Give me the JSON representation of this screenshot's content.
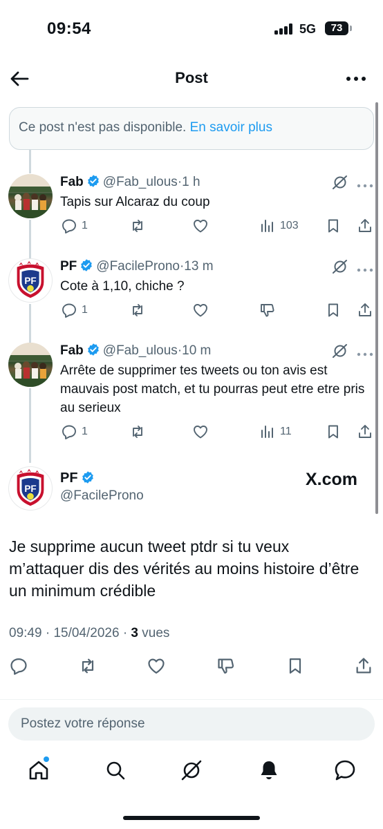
{
  "status_bar": {
    "time": "09:54",
    "network": "5G",
    "battery": "73"
  },
  "header": {
    "title": "Post"
  },
  "notice": {
    "text": "Ce post n'est pas disponible.",
    "link": "En savoir plus"
  },
  "thread": [
    {
      "name": "Fab",
      "handle": "@Fab_ulous",
      "separator": "·",
      "time": "1 h",
      "text": "Tapis sur Alcaraz du coup",
      "replies": "1",
      "views": "103",
      "third_action": "views-icon"
    },
    {
      "name": "PF",
      "handle": "@FacileProno",
      "separator": "·",
      "time": "13 m",
      "text": "Cote à 1,10, chiche ?",
      "replies": "1",
      "views": "",
      "third_action": "dislike-icon"
    },
    {
      "name": "Fab",
      "handle": "@Fab_ulous",
      "separator": "·",
      "time": "10 m",
      "text": "Arrête de supprimer tes tweets ou ton avis est mauvais post match, et tu pourras peut etre etre pris au serieux",
      "replies": "1",
      "views": "11",
      "third_action": "views-icon"
    }
  ],
  "main_post": {
    "name": "PF",
    "handle": "@FacileProno",
    "watermark": "X.com",
    "text": "Je supprime aucun tweet ptdr si tu veux m’attaquer dis des vérités au moins histoire d’être un minimum crédible",
    "time": "09:49",
    "date": "15/04/2026",
    "separator": "·",
    "views_count": "3",
    "views_label": "vues"
  },
  "reply": {
    "placeholder": "Postez votre réponse"
  },
  "tabs": [
    "home-icon",
    "search-icon",
    "grok-icon",
    "notifications-icon",
    "messages-icon"
  ],
  "colors": {
    "accent": "#1d9bf0",
    "text": "#0f1419",
    "secondary": "#536471",
    "border": "#cfd9de"
  }
}
